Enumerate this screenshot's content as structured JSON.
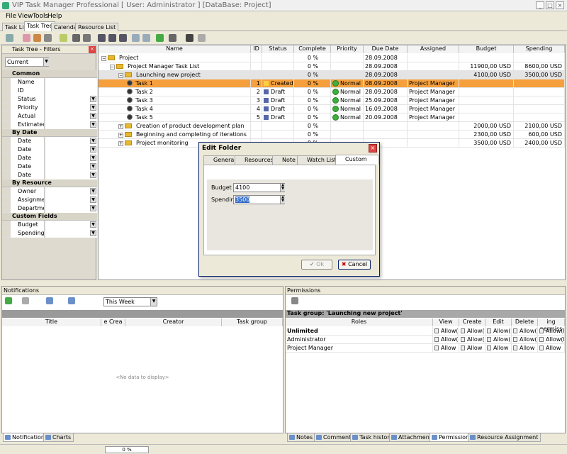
{
  "app": {
    "title": "VIP Task Manager Professional [ User: Administrator ] [DataBase: Project]",
    "menu": [
      "File",
      "View",
      "Tools",
      "Help"
    ],
    "tabs": [
      "Task List",
      "Task Tree",
      "Calendar",
      "Resource List"
    ],
    "active_tab": "Task Tree"
  },
  "filters": {
    "header": "Task Tree - Filters",
    "preset": "Current",
    "sections": [
      {
        "name": "Common",
        "items": [
          "Name",
          "ID",
          "Status",
          "Priority",
          "Actual time",
          "Estimated Ti"
        ]
      },
      {
        "name": "By Date",
        "items": [
          "Date Range",
          "Date Create",
          "Date Last M",
          "Date Started",
          "Date Compl"
        ]
      },
      {
        "name": "By Resource",
        "items": [
          "Owner",
          "Assignment",
          "Department"
        ]
      },
      {
        "name": "Custom Fields",
        "items": [
          "Budget",
          "Spending"
        ]
      }
    ]
  },
  "tree": {
    "columns": [
      "Name",
      "ID",
      "Status",
      "Complete",
      "Priority",
      "Due Date",
      "Assigned",
      "Budget",
      "Spending"
    ],
    "rows": [
      {
        "name": "Project",
        "id": "",
        "status": "",
        "complete": "0 %",
        "priority": "",
        "due": "28.09.2008",
        "assigned": "",
        "budget": "",
        "spending": ""
      },
      {
        "name": "Project Manager Task List",
        "id": "",
        "status": "",
        "complete": "0 %",
        "priority": "",
        "due": "28.09.2008",
        "assigned": "",
        "budget": "11900,00 USD",
        "spending": "8600,00 USD"
      },
      {
        "name": "Launching new project",
        "id": "",
        "status": "",
        "complete": "0 %",
        "priority": "",
        "due": "28.09.2008",
        "assigned": "",
        "budget": "4100,00 USD",
        "spending": "3500,00 USD"
      },
      {
        "name": "Task 1",
        "id": "1",
        "status": "Created",
        "complete": "0 %",
        "priority": "Normal",
        "due": "08.09.2008",
        "assigned": "Project Manager",
        "budget": "",
        "spending": ""
      },
      {
        "name": "Task 2",
        "id": "2",
        "status": "Draft",
        "complete": "0 %",
        "priority": "Normal",
        "due": "28.09.2008",
        "assigned": "Project Manager",
        "budget": "",
        "spending": ""
      },
      {
        "name": "Task 3",
        "id": "3",
        "status": "Draft",
        "complete": "0 %",
        "priority": "Normal",
        "due": "25.09.2008",
        "assigned": "Project Manager",
        "budget": "",
        "spending": ""
      },
      {
        "name": "Task 4",
        "id": "4",
        "status": "Draft",
        "complete": "0 %",
        "priority": "Normal",
        "due": "16.09.2008",
        "assigned": "Project Manager",
        "budget": "",
        "spending": ""
      },
      {
        "name": "Task 5",
        "id": "5",
        "status": "Draft",
        "complete": "0 %",
        "priority": "Normal",
        "due": "20.09.2008",
        "assigned": "Project Manager",
        "budget": "",
        "spending": ""
      },
      {
        "name": "Creation of product development plan",
        "id": "",
        "status": "",
        "complete": "0 %",
        "priority": "",
        "due": "",
        "assigned": "",
        "budget": "2000,00 USD",
        "spending": "2100,00 USD"
      },
      {
        "name": "Beginning and completing of iterations",
        "id": "",
        "status": "",
        "complete": "0 %",
        "priority": "",
        "due": "",
        "assigned": "",
        "budget": "2300,00 USD",
        "spending": "600,00 USD"
      },
      {
        "name": "Project monitoring",
        "id": "",
        "status": "",
        "complete": "0 %",
        "priority": "",
        "due": "",
        "assigned": "",
        "budget": "3500,00 USD",
        "spending": "2400,00 USD"
      }
    ],
    "row_count": "14"
  },
  "dialog": {
    "title": "Edit Folder",
    "tabs": [
      "General",
      "Resources",
      "Note",
      "Watch List",
      "Custom Fields"
    ],
    "budget_label": "Budget",
    "budget_value": "4100",
    "spending_label": "Spending",
    "spending_value": "3500",
    "ok": "Ok",
    "cancel": "Cancel"
  },
  "notifications": {
    "header": "Notifications",
    "period": "This Week",
    "columns": [
      "Title",
      "e Crea",
      "Creator",
      "Task group"
    ],
    "empty": "<No data to display>"
  },
  "permissions": {
    "header": "Permissions",
    "group_label": "Task group: 'Launching new project'",
    "columns": [
      "Roles",
      "View",
      "Create",
      "Edit",
      "Delete",
      "ing permiss"
    ],
    "rows": [
      {
        "role": "Unlimited",
        "cells": [
          "Allow(E",
          "Allow(E",
          "Allow(E",
          "Allow(E",
          "Allow(E"
        ]
      },
      {
        "role": "Administrator",
        "cells": [
          "Allow(E",
          "Allow(E",
          "Allow(E",
          "Allow(E",
          "Allow(E"
        ]
      },
      {
        "role": "Project Manager",
        "cells": [
          "Allow",
          "Allow",
          "Allow",
          "Allow",
          "Allow"
        ]
      }
    ]
  },
  "bottom_tabs_left": [
    "Notifications",
    "Charts"
  ],
  "bottom_tabs_right": [
    "Notes",
    "Comments",
    "Task history",
    "Attachments",
    "Permissions",
    "Resource Assignment"
  ],
  "status": {
    "progress": "0 %"
  }
}
